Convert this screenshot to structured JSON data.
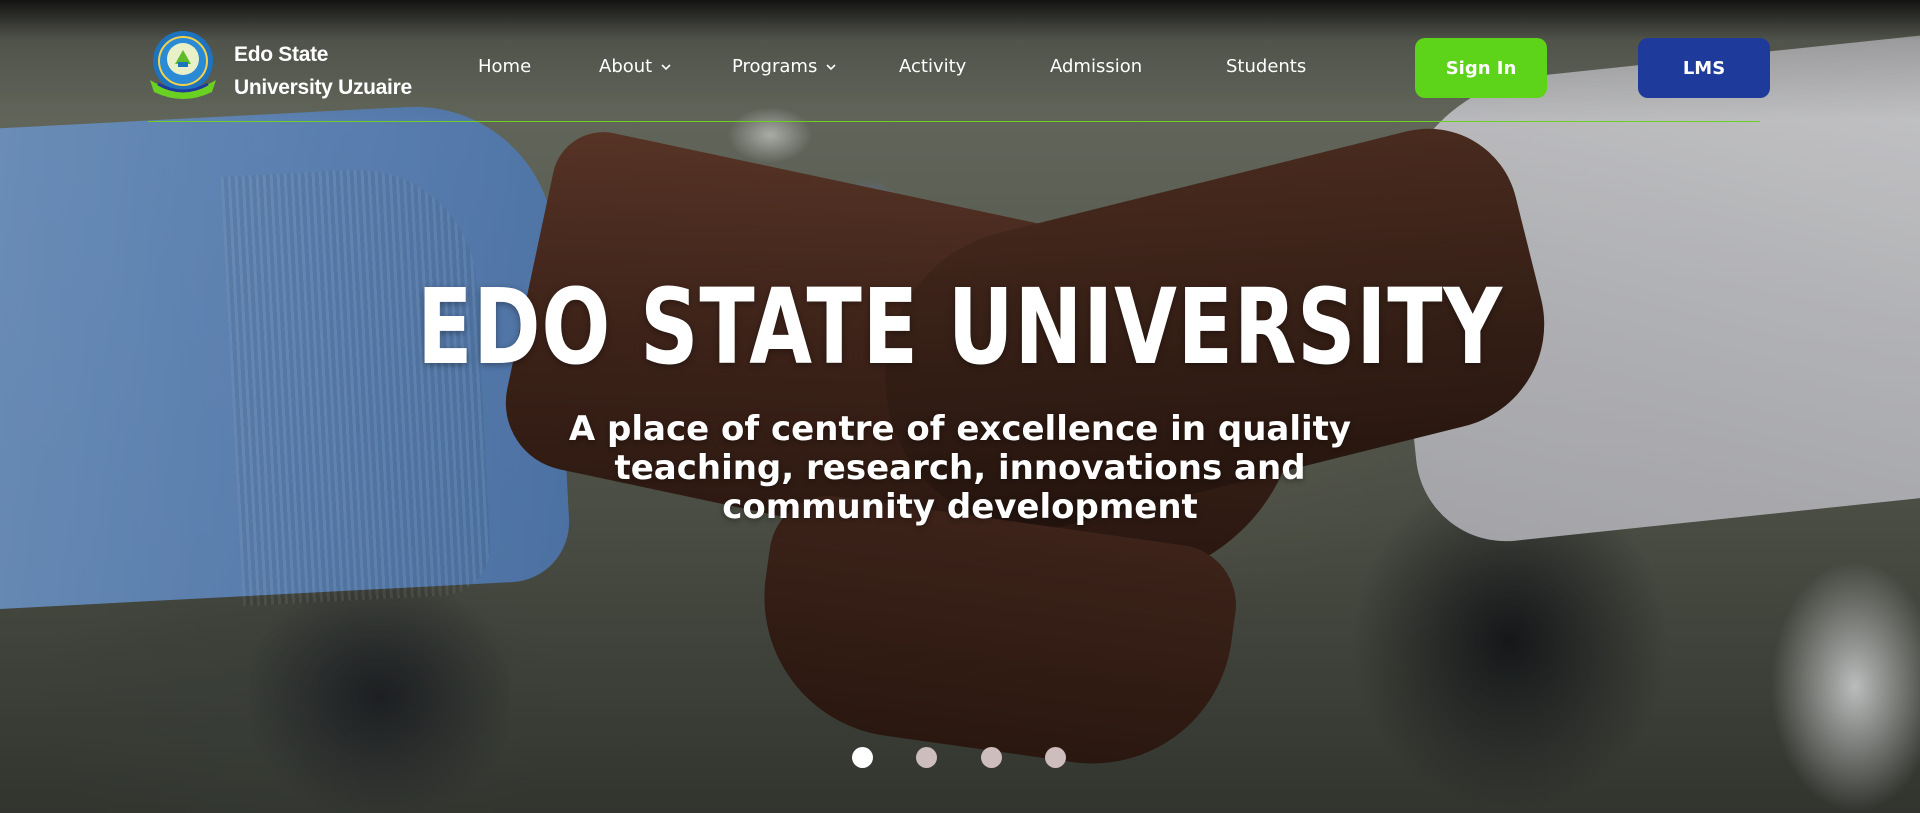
{
  "brand": {
    "line1": "Edo State",
    "line2": "University Uzuaire"
  },
  "logo": {
    "icon": "university-crest-icon",
    "colors": [
      "#1e73be",
      "#6ad123",
      "#f2d24a"
    ]
  },
  "nav": {
    "items": [
      {
        "label": "Home",
        "dropdown": false
      },
      {
        "label": "About",
        "dropdown": true
      },
      {
        "label": "Programs",
        "dropdown": true
      },
      {
        "label": "Activity",
        "dropdown": false
      },
      {
        "label": "Admission",
        "dropdown": false
      },
      {
        "label": "Students",
        "dropdown": false
      }
    ]
  },
  "actions": {
    "signin_label": "Sign In",
    "lms_label": "LMS"
  },
  "hero": {
    "title": "EDO STATE UNIVERSITY",
    "subtitle": "A place of  centre of excellence in quality teaching, research, innovations and community development",
    "image": "handshake-photo"
  },
  "carousel": {
    "slide_count": 4,
    "active_index": 0
  },
  "colors": {
    "accent_green": "#5dd319",
    "lms_blue": "#1e3a9b",
    "divider_green": "#6ad123",
    "dot_inactive": "#cdbdbd",
    "dot_active": "#ffffff"
  }
}
